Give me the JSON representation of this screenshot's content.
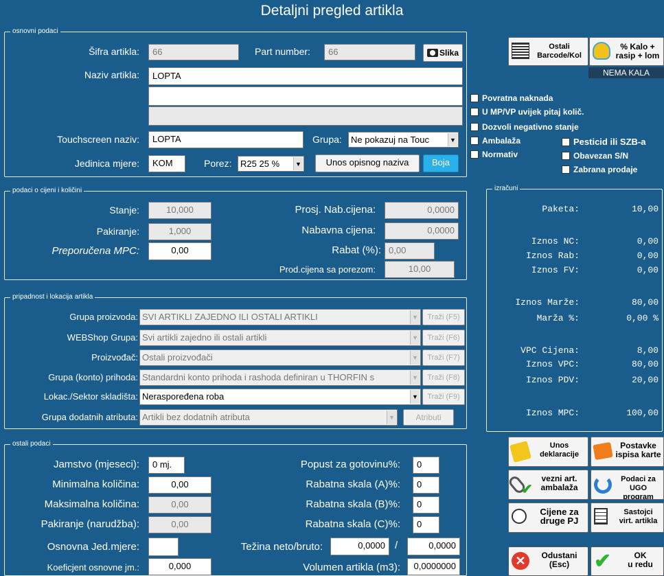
{
  "window": {
    "title": "Detaljni pregled artikla"
  },
  "osnovni": {
    "legend": "osnovni podaci",
    "sifra_label": "Šifra artikla:",
    "sifra_value": "66",
    "part_label": "Part number:",
    "part_value": "66",
    "slika_label": "Slika",
    "naziv_label": "Naziv artikla:",
    "naziv_value": "LOPTA",
    "touch_label": "Touchscreen naziv:",
    "touch_value": "LOPTA",
    "grupa_label": "Grupa:",
    "grupa_value": "Ne pokazuj na Touc",
    "jedinica_label": "Jedinica mjere:",
    "jedinica_value": "KOM",
    "porez_label": "Porez:",
    "porez_value": "R25  25 %",
    "unos_label": "Unos opisnog naziva",
    "boja_label": "Boja",
    "checkboxes": [
      "Povratna naknada",
      "U MP/VP uvijek pitaj količ.",
      "Dozvoli negativno stanje",
      "Ambalaža",
      "Normativ"
    ],
    "checkboxes_right": [
      "Pesticid ili SZB-a",
      "Obavezan S/N",
      "Zabrana prodaje"
    ]
  },
  "top_buttons": {
    "barcode": "Ostali\nBarcode/Kol",
    "kalo": "% Kalo +\nrasip + lom",
    "nema_kala": "NEMA KALA"
  },
  "cijene": {
    "legend": "podaci o cijeni i količini",
    "stanje_label": "Stanje:",
    "stanje_value": "10,000",
    "pakiranje_label": "Pakiranje:",
    "pakiranje_value": "1,000",
    "mpc_label": "Preporučena MPC:",
    "mpc_value": "0,00",
    "prosj_label": "Prosj. Nab.cijena:",
    "prosj_value": "0,0000",
    "nabavna_label": "Nabavna cijena:",
    "nabavna_value": "0,0000",
    "rabat_label": "Rabat (%):",
    "rabat_value": "0,00",
    "prod_label": "Prod.cijena sa porezom:",
    "prod_value": "10,00"
  },
  "izracuni": {
    "legend": "izračuni",
    "rows": [
      {
        "label": "Paketa:",
        "value": "10,00"
      },
      {
        "label": "Iznos NC:",
        "value": "0,00"
      },
      {
        "label": "Iznos Rab:",
        "value": "0,00"
      },
      {
        "label": "Iznos FV:",
        "value": "0,00"
      },
      {
        "label": "Iznos Marže:",
        "value": "80,00"
      },
      {
        "label": "Marža %:",
        "value": "0,00 %"
      },
      {
        "label": "VPC Cijena:",
        "value": "8,00"
      },
      {
        "label": "Iznos VPC:",
        "value": "80,00"
      },
      {
        "label": "Iznos PDV:",
        "value": "20,00"
      },
      {
        "label": "Iznos MPC:",
        "value": "100,00"
      }
    ]
  },
  "pripadnost": {
    "legend": "pripadnost i lokacija artikla",
    "rows": [
      {
        "label": "Grupa proizvoda:",
        "value": "SVI ARTIKLI ZAJEDNO ILI OSTALI ARTIKLI",
        "btn": "Traži (F5)"
      },
      {
        "label": "WEBShop Grupa:",
        "value": "Svi artikli zajedno ili ostali artikli",
        "btn": "Traži (F6)"
      },
      {
        "label": "Proizvođač:",
        "value": "Ostali proizvođači",
        "btn": "Traži (F7)"
      },
      {
        "label": "Grupa (konto) prihoda:",
        "value": "Standardni konto prihoda i rashoda definiran u THORFIN s",
        "btn": "Traži (F8)"
      },
      {
        "label": "Lokac./Sektor skladišta:",
        "value": "Neraspoređena roba",
        "btn": "Traži (F9)"
      }
    ],
    "atributi_label": "Grupa dodatnih atributa:",
    "atributi_value": "Artikli bez dodatnih atributa",
    "atributi_btn": "Atributi"
  },
  "ostali": {
    "legend": "ostali podaci",
    "jamstvo_label": "Jamstvo (mjeseci):",
    "jamstvo_value": "0 mj.",
    "min_label": "Minimalna količina:",
    "min_value": "0,00",
    "max_label": "Maksimalna količina:",
    "max_value": "0,00",
    "pak_label": "Pakiranje (narudžba):",
    "pak_value": "0,00",
    "osnovna_label": "Osnovna Jed.mjere:",
    "osnovna_value": "",
    "koef_label": "Koeficjent osnovne jm.:",
    "koef_value": "0,000",
    "popust_label": "Popust za gotovinu%:",
    "popust_value": "0",
    "rab_a_label": "Rabatna skala (A)%:",
    "rab_a_value": "0",
    "rab_b_label": "Rabatna skala (B)%:",
    "rab_b_value": "0",
    "rab_c_label": "Rabatna skala (C)%:",
    "rab_c_value": "0",
    "tezina_label": "Težina neto/bruto:",
    "tezina_neto": "0,0000",
    "tezina_sep": "/",
    "tezina_bruto": "0,0000",
    "volumen_label": "Volumen artikla (m3):",
    "volumen_value": "0,0000000"
  },
  "side_buttons": {
    "deklaracije": "Unos\ndeklaracije",
    "postavke": "Postavke\nispisa karte",
    "vezni": "vezni art.\nambalaža",
    "ugo": "Podaci za\nUGO program",
    "cijene": "Cijene za\ndruge PJ",
    "sastojci": "Sastojci\nvirt. artikla",
    "odustani": "Odustani\n(Esc)",
    "ok": "OK\nu redu"
  }
}
